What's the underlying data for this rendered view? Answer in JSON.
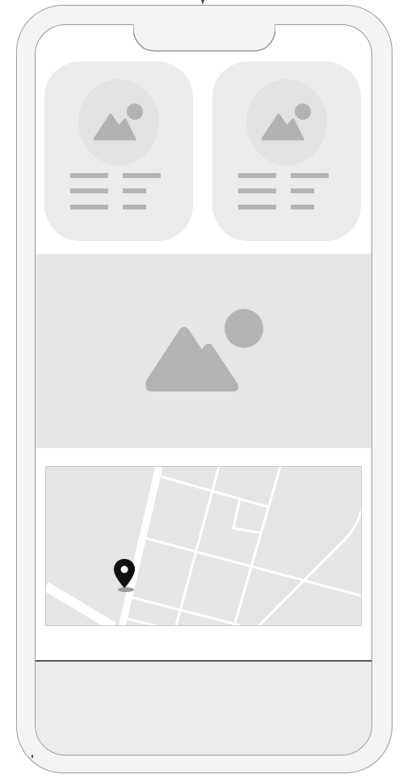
{
  "device": {
    "type": "phone-wireframe",
    "frame_color": "#f4f4f4",
    "screen_color": "#ffffff"
  },
  "cards": [
    {
      "icon": "image-placeholder-icon",
      "text_lines": 6
    },
    {
      "icon": "image-placeholder-icon",
      "text_lines": 6
    }
  ],
  "hero": {
    "icon": "image-placeholder-icon",
    "background": "#e6e6e6"
  },
  "map": {
    "icon": "map-pin-icon",
    "pin_color": "#111111",
    "background": "#e5e5e5"
  },
  "bottom_bar": {
    "background": "#ebebeb"
  }
}
